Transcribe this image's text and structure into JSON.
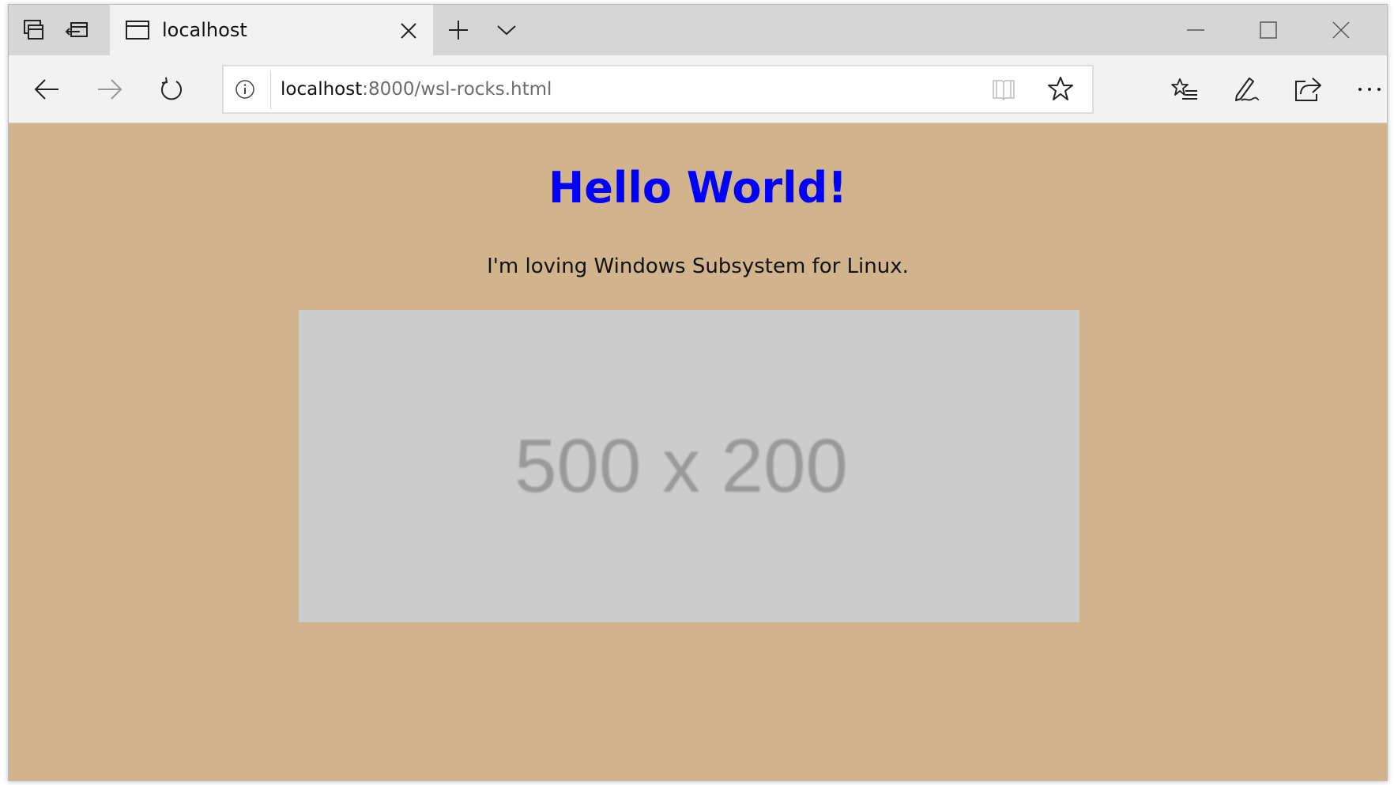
{
  "browser": {
    "tab": {
      "title": "localhost"
    },
    "address": {
      "host": "localhost",
      "rest": ":8000/wsl-rocks.html"
    },
    "icons": {
      "tab_actions": "tab-actions-icon",
      "set_aside": "set-aside-tabs-icon",
      "page_icon": "page-icon",
      "close_tab": "close-icon",
      "new_tab": "plus-icon",
      "tab_preview": "chevron-down-icon",
      "minimize": "minimize-icon",
      "maximize": "maximize-icon",
      "close_window": "close-icon",
      "back": "back-arrow-icon",
      "forward": "forward-arrow-icon",
      "refresh": "refresh-icon",
      "info": "info-icon",
      "reading_view": "book-icon",
      "favorite": "star-icon",
      "favorites_hub": "favorites-list-icon",
      "web_note": "pen-icon",
      "share": "share-icon",
      "more": "more-icon"
    }
  },
  "page": {
    "heading": "Hello World!",
    "text": "I'm loving Windows Subsystem for Linux.",
    "image_placeholder": "500 x 200",
    "background_color": "#d2b48c",
    "heading_color": "#0000ff"
  }
}
